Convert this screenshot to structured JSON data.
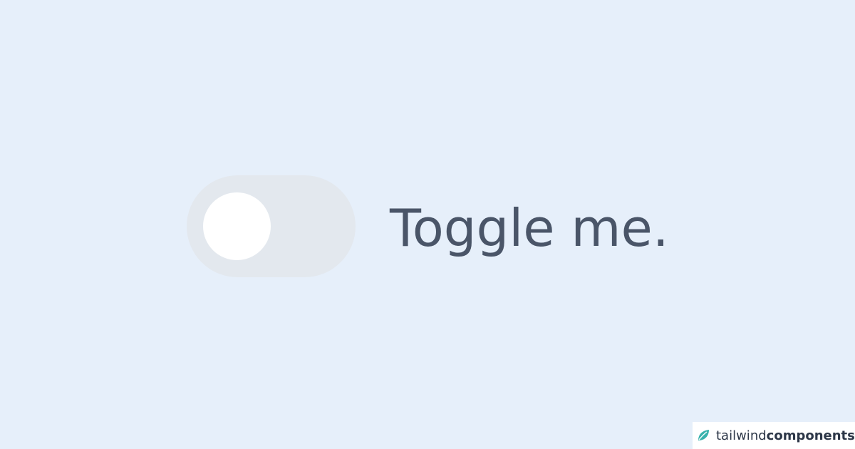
{
  "toggle": {
    "label": "Toggle me.",
    "state": "off"
  },
  "brand": {
    "name_light": "tailwind",
    "name_bold": "components",
    "icon": "leaf-icon"
  },
  "colors": {
    "background": "#e6effa",
    "track": "#e3e8ee",
    "knob": "#ffffff",
    "label_text": "#4a5568",
    "brand_accent": "#38b2ac"
  }
}
